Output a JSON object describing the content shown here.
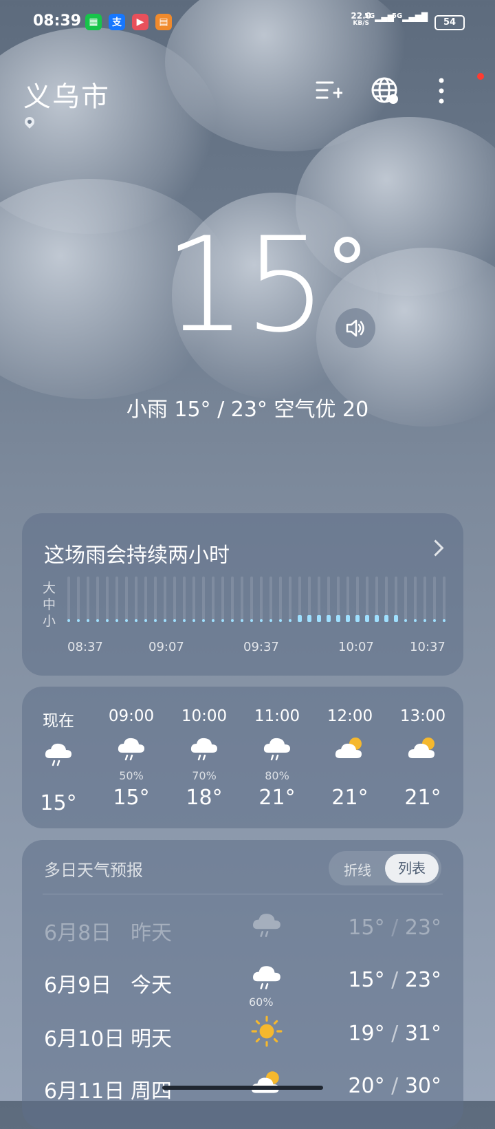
{
  "status": {
    "time": "08:39",
    "net_speed": "22.0",
    "net_unit": "KB/S",
    "sig1": "5G",
    "sig2": "5G",
    "battery": "54"
  },
  "header": {
    "city": "义乌市",
    "icons": [
      "city-list-add-icon",
      "globe-icon",
      "more-icon"
    ]
  },
  "current": {
    "temp": "15",
    "summary": "小雨  15° / 23°  空气优 20"
  },
  "rain": {
    "title": "这场雨会持续两小时",
    "levels": [
      "大",
      "中",
      "小"
    ],
    "times": [
      "08:37",
      "09:07",
      "09:37",
      "10:07",
      "10:37"
    ]
  },
  "hourly": [
    {
      "time": "现在",
      "icon": "rain-icon",
      "pop": "",
      "temp": "15°"
    },
    {
      "time": "09:00",
      "icon": "rain-icon",
      "pop": "50%",
      "temp": "15°"
    },
    {
      "time": "10:00",
      "icon": "rain-icon",
      "pop": "70%",
      "temp": "18°"
    },
    {
      "time": "11:00",
      "icon": "rain-icon",
      "pop": "80%",
      "temp": "21°"
    },
    {
      "time": "12:00",
      "icon": "partly-cloudy-icon",
      "pop": "",
      "temp": "21°"
    },
    {
      "time": "13:00",
      "icon": "partly-cloudy-icon",
      "pop": "",
      "temp": "21°"
    }
  ],
  "daily": {
    "title": "多日天气预报",
    "toggle_line": "折线",
    "toggle_list": "列表",
    "rows": [
      {
        "date": "6月8日",
        "day": "昨天",
        "icon": "rain-icon",
        "pop": "",
        "low": "15°",
        "high": "23°"
      },
      {
        "date": "6月9日",
        "day": "今天",
        "icon": "rain-icon",
        "pop": "60%",
        "low": "15°",
        "high": "23°"
      },
      {
        "date": "6月10日",
        "day": "明天",
        "icon": "sun-icon",
        "pop": "",
        "low": "19°",
        "high": "31°"
      },
      {
        "date": "6月11日",
        "day": "周四",
        "icon": "partly-cloudy-icon",
        "pop": "",
        "low": "20°",
        "high": "30°"
      }
    ]
  },
  "colors": {
    "sun": "#f5b82e",
    "card": "#5f7088"
  }
}
